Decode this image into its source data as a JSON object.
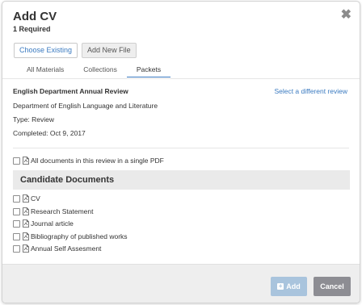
{
  "modal": {
    "title": "Add CV",
    "required": "1 Required",
    "close_icon": "close-icon"
  },
  "top_tabs": [
    {
      "label": "Choose Existing",
      "active": true
    },
    {
      "label": "Add New File",
      "active": false
    }
  ],
  "sub_tabs": [
    {
      "label": "All Materials",
      "active": false
    },
    {
      "label": "Collections",
      "active": false
    },
    {
      "label": "Packets",
      "active": true
    }
  ],
  "review": {
    "title": "English Department Annual Review",
    "select_link": "Select a different review",
    "department": "Department of English Language and Literature",
    "type": "Type: Review",
    "completed": "Completed: Oct 9, 2017"
  },
  "single_pdf_option": "All documents in this review in a single PDF",
  "candidate_section": {
    "title": "Candidate Documents",
    "items": [
      "CV",
      "Research Statement",
      "Journal article",
      "Bibliography of published works",
      "Annual Self Assesment"
    ]
  },
  "footer": {
    "add_label": "Add",
    "cancel_label": "Cancel"
  },
  "colors": {
    "link_blue": "#3a7ac0",
    "add_button": "#a9c4dd",
    "cancel_button": "#8d8d93"
  }
}
